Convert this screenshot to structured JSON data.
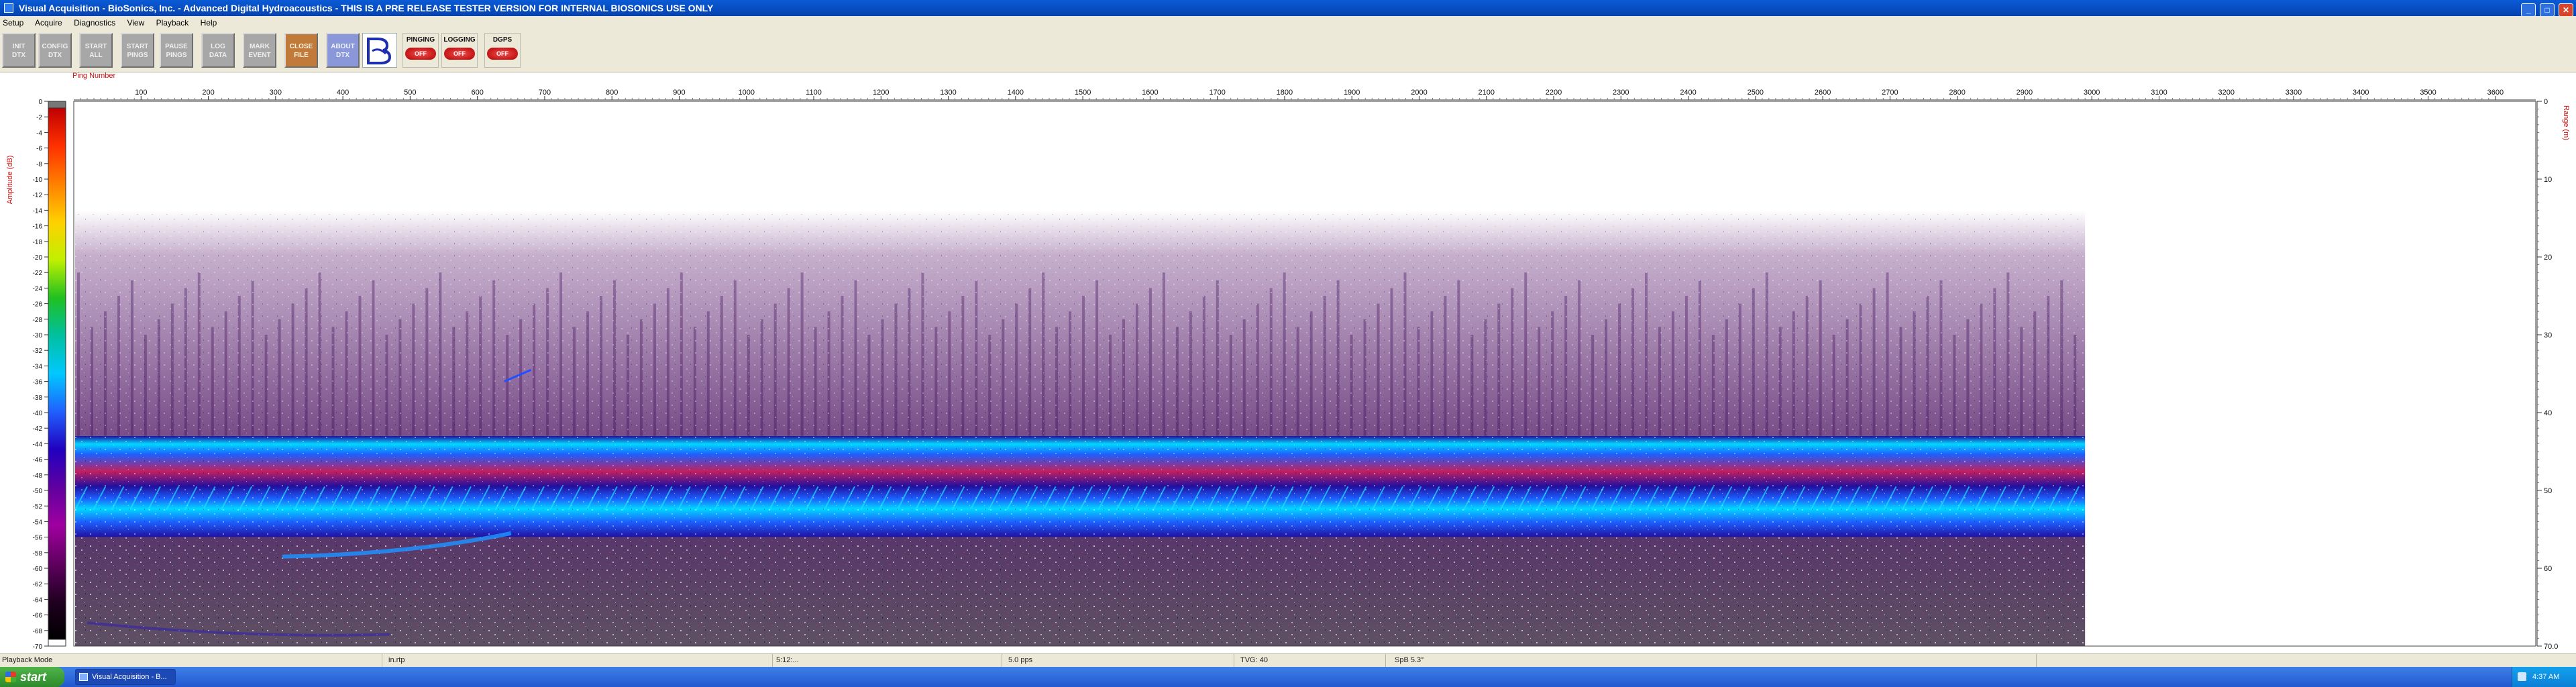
{
  "window": {
    "title": "Visual Acquisition  -  BioSonics, Inc.  -  Advanced Digital Hydroacoustics  -  THIS IS A PRE RELEASE TESTER VERSION FOR INTERNAL BIOSONICS USE ONLY",
    "minimize_glyph": "_",
    "maximize_glyph": "□",
    "close_glyph": "✕"
  },
  "menu": [
    "Setup",
    "Acquire",
    "Diagnostics",
    "View",
    "Playback",
    "Help"
  ],
  "toolbar": {
    "buttons": [
      {
        "line1": "INIT",
        "line2": "DTX"
      },
      {
        "line1": "CONFIG",
        "line2": "DTX"
      },
      {
        "line1": "START",
        "line2": "ALL"
      },
      {
        "line1": "START",
        "line2": "PINGS"
      },
      {
        "line1": "PAUSE",
        "line2": "PINGS"
      },
      {
        "line1": "LOG",
        "line2": "DATA"
      },
      {
        "line1": "MARK",
        "line2": "EVENT"
      },
      {
        "line1": "CLOSE",
        "line2": "FILE"
      },
      {
        "line1": "ABOUT",
        "line2": "DTX"
      }
    ],
    "logo_icon": "biosonics-logo-icon",
    "indicators": [
      {
        "label": "PINGING",
        "state": "OFF"
      },
      {
        "label": "LOGGING",
        "state": "OFF"
      },
      {
        "label": "DGPS",
        "state": "OFF"
      }
    ]
  },
  "echogram": {
    "x_axis_title": "Ping Number",
    "left_axis_title": "Amplitude (dB)",
    "right_axis_title": "Range (m)",
    "x_ticks": [
      100,
      200,
      300,
      400,
      500,
      600,
      700,
      800,
      900,
      1000,
      1100,
      1200,
      1300,
      1400,
      1500,
      1600,
      1700,
      1800,
      1900,
      2000,
      2100,
      2200,
      2300,
      2400,
      2500,
      2600,
      2700,
      2800,
      2900,
      3000,
      3100,
      3200,
      3300,
      3400,
      3500,
      3600
    ],
    "x_range": [
      0,
      3660
    ],
    "data_last_ping": 2990,
    "amplitude_ticks": [
      0,
      -2,
      -4,
      -6,
      -8,
      -10,
      -12,
      -14,
      -16,
      -18,
      -20,
      -22,
      -24,
      -26,
      -28,
      -30,
      -32,
      -34,
      -36,
      -38,
      -40,
      -42,
      -44,
      -46,
      -48,
      -50,
      -52,
      -54,
      -56,
      -58,
      -60,
      -62,
      -64,
      -66,
      -68,
      -70
    ],
    "amplitude_range": [
      0,
      -70
    ],
    "range_ticks": [
      0,
      10,
      20,
      30,
      40,
      50,
      60,
      70
    ],
    "range_tick_labels": [
      "0",
      "10",
      "20",
      "30",
      "40",
      "50",
      "60",
      "70.0"
    ],
    "range_max_m": 70,
    "colorbar_colors": [
      "#c00000",
      "#ff3000",
      "#ff8000",
      "#ffd000",
      "#c0f000",
      "#20c020",
      "#00c0a0",
      "#00c8ff",
      "#2060ff",
      "#2000c0",
      "#6000a0",
      "#a000a0",
      "#600060",
      "#200020",
      "#000000"
    ],
    "echo_colors": {
      "background": "#ffffff",
      "noise": "#5a1a6e",
      "band_core": "#00d8ff",
      "band_mid": "#1c60ff",
      "band_edge": "#2010a0",
      "bottom_noise": "#2a0a3a"
    }
  },
  "statusbar": {
    "mode": "Playback Mode",
    "file": "in.rtp",
    "time": "5:12:...",
    "rate": "5.0 pps",
    "tvg": "TVG: 40",
    "spl": "SpB 5.3°"
  },
  "taskbar": {
    "start_label": "start",
    "task_label": "Visual Acquisition - B...",
    "clock": "4:37 AM"
  }
}
